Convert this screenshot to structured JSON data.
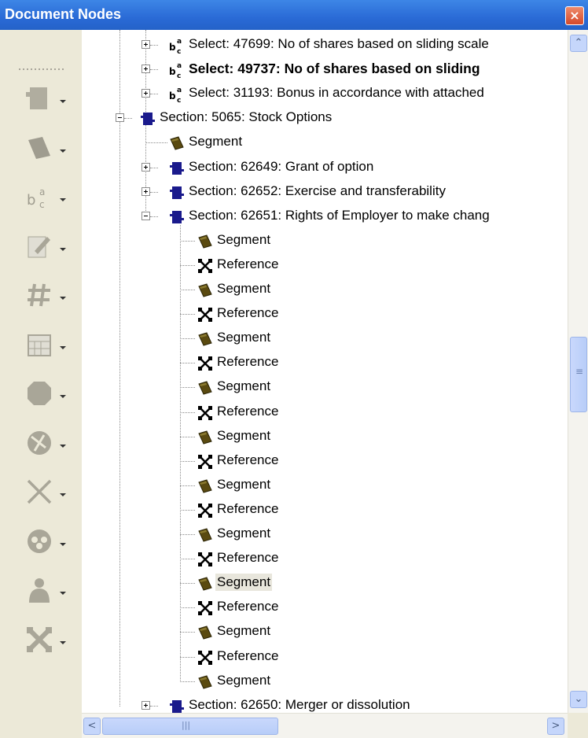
{
  "window": {
    "title": "Document Nodes",
    "close_glyph": "×"
  },
  "toolbar": {
    "tools": [
      {
        "icon": "section-icon"
      },
      {
        "icon": "segment-icon"
      },
      {
        "icon": "select-icon"
      },
      {
        "icon": "edit-form-icon"
      },
      {
        "icon": "number-icon"
      },
      {
        "icon": "calendar-icon"
      },
      {
        "icon": "stop-icon"
      },
      {
        "icon": "tools-icon"
      },
      {
        "icon": "reference-icon"
      },
      {
        "icon": "group-icon"
      },
      {
        "icon": "person-icon"
      },
      {
        "icon": "collapse-icon"
      }
    ]
  },
  "tree": {
    "nodes": [
      {
        "type": "select",
        "label": "Select: 47699: No of shares based on sliding scale",
        "expander": "plus",
        "level": 2
      },
      {
        "type": "select",
        "label": "Select: 49737: No of shares based on sliding",
        "expander": "plus",
        "level": 2,
        "bold": true
      },
      {
        "type": "select",
        "label": "Select: 31193: Bonus in accordance with attached",
        "expander": "plus",
        "level": 2
      },
      {
        "type": "section",
        "label": "Section: 5065: Stock Options",
        "expander": "minus",
        "level": 1
      },
      {
        "type": "segment",
        "label": "Segment",
        "level": 2
      },
      {
        "type": "section",
        "label": "Section: 62649: Grant of option",
        "expander": "plus",
        "level": 2
      },
      {
        "type": "section",
        "label": "Section: 62652: Exercise and transferability",
        "expander": "plus",
        "level": 2
      },
      {
        "type": "section",
        "label": "Section: 62651: Rights of Employer to make chang",
        "expander": "minus",
        "level": 2
      },
      {
        "type": "segment",
        "label": "Segment",
        "level": 3
      },
      {
        "type": "reference",
        "label": "Reference",
        "level": 3
      },
      {
        "type": "segment",
        "label": "Segment",
        "level": 3
      },
      {
        "type": "reference",
        "label": "Reference",
        "level": 3
      },
      {
        "type": "segment",
        "label": "Segment",
        "level": 3
      },
      {
        "type": "reference",
        "label": "Reference",
        "level": 3
      },
      {
        "type": "segment",
        "label": "Segment",
        "level": 3
      },
      {
        "type": "reference",
        "label": "Reference",
        "level": 3
      },
      {
        "type": "segment",
        "label": "Segment",
        "level": 3
      },
      {
        "type": "reference",
        "label": "Reference",
        "level": 3
      },
      {
        "type": "segment",
        "label": "Segment",
        "level": 3
      },
      {
        "type": "reference",
        "label": "Reference",
        "level": 3
      },
      {
        "type": "segment",
        "label": "Segment",
        "level": 3
      },
      {
        "type": "reference",
        "label": "Reference",
        "level": 3
      },
      {
        "type": "segment",
        "label": "Segment",
        "level": 3,
        "selected": true
      },
      {
        "type": "reference",
        "label": "Reference",
        "level": 3
      },
      {
        "type": "segment",
        "label": "Segment",
        "level": 3
      },
      {
        "type": "reference",
        "label": "Reference",
        "level": 3
      },
      {
        "type": "segment",
        "label": "Segment",
        "level": 3
      },
      {
        "type": "section",
        "label": "Section: 62650: Merger or dissolution",
        "expander": "plus",
        "level": 2
      }
    ]
  },
  "scrollbars": {
    "up_glyph": "⌃",
    "down_glyph": "⌄",
    "left_glyph": "<",
    "right_glyph": ">",
    "grip_glyph": "≡",
    "hgrip_glyph": "|||"
  },
  "colors": {
    "title_bar": "#2a6ad6",
    "section_icon": "#1a1a8c",
    "segment_icon": "#5a4a10",
    "selection": "#e8e6dc",
    "toolbar_bg": "#ece9d8"
  }
}
